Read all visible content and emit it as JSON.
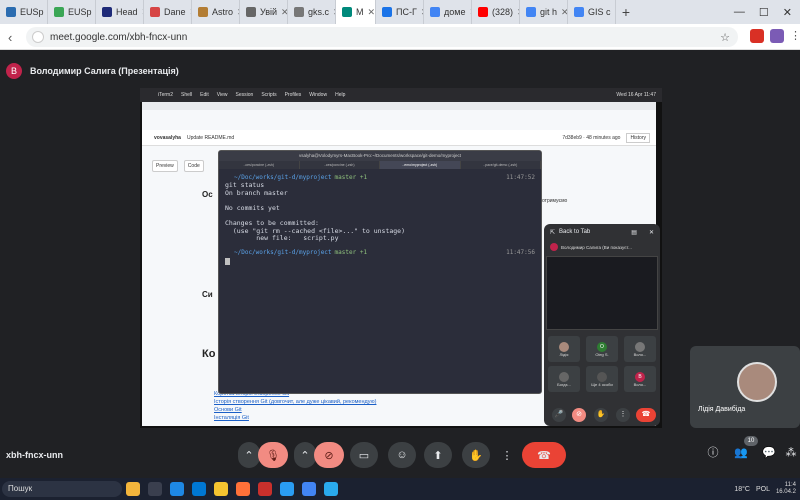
{
  "browser": {
    "tabs": [
      {
        "label": "EUSp",
        "color": "#2b6cb0"
      },
      {
        "label": "EUSp",
        "color": "#3aa655"
      },
      {
        "label": "Head",
        "color": "#1e2a78"
      },
      {
        "label": "Dane",
        "color": "#d64545"
      },
      {
        "label": "Astro",
        "color": "#b37d34"
      },
      {
        "label": "Увій",
        "color": "#666"
      },
      {
        "label": "gks.c",
        "color": "#777"
      },
      {
        "label": "M",
        "color": "#00897b",
        "active": true
      },
      {
        "label": "ПС-Г",
        "color": "#1a73e8"
      },
      {
        "label": "доме",
        "color": "#4285f4"
      },
      {
        "label": "(328)",
        "color": "#ff0000"
      },
      {
        "label": "git h",
        "color": "#4285f4"
      },
      {
        "label": "GIS c",
        "color": "#4285f4"
      }
    ],
    "url": "meet.google.com/xbh-fncx-unn"
  },
  "meet": {
    "presenter_avatar": "В",
    "presenter_title": "Володимир Салига (Презентація)",
    "meeting_code": "xbh-fncx-unn",
    "participants_count": "10"
  },
  "shared": {
    "mac_menu": [
      "iTerm2",
      "Shell",
      "Edit",
      "View",
      "Session",
      "Scripts",
      "Profiles",
      "Window",
      "Help"
    ],
    "mac_clock": "Wed 16 Apr  11:47",
    "gh_user": "vovasalyha",
    "gh_commit": "Update README.md",
    "gh_hash": "7d38eb9 · 48 minutes ago",
    "gh_history": "History",
    "gh_tabs": [
      "Preview",
      "Code"
    ],
    "doc_heading1": "Ос",
    "doc_heading2": "Си",
    "doc_heading3": "Ко",
    "doc_side_text": "отримуємо",
    "toc_links": [
      "Коротка історія створення Git",
      "Історія створення Git (довгочит, але дуже цікавий, рекомендую)",
      "Основи Git",
      "Інсталяція Git"
    ],
    "terminal": {
      "title": "vsalyha@Volodymyrs-MacBook-Pro:~/Documents/workspace/git-demo/myproject",
      "tabs": [
        "..ces/poncine (-zsh)",
        "..ces/poncine (-zsh)",
        "..emo/myproject (-zsh)",
        "..pace/git-demo (-zsh)"
      ],
      "prompt_path": "~/Doc/works/git-d/myproject",
      "branch": "master +1",
      "time1": "11:47:52",
      "time2": "11:47:56",
      "lines": [
        "git status",
        "On branch master",
        "",
        "No commits yet",
        "",
        "Changes to be committed:",
        "  (use \"git rm --cached <file>...\" to unstage)",
        "        new file:   script.py"
      ]
    }
  },
  "pip": {
    "back_label": "Back to Tab",
    "presenting": "Володимир Салига (Ви показуєт...",
    "tiles": [
      {
        "label": "Лідія",
        "initial": "",
        "color": "#a98a7c"
      },
      {
        "label": "Oleg S.",
        "initial": "O",
        "color": "#2e7d32"
      },
      {
        "label": "Воло...",
        "initial": "",
        "color": "#777"
      },
      {
        "label": "Богдз...",
        "initial": "",
        "color": "#666"
      },
      {
        "label": "Ще 4 особи",
        "initial": "",
        "color": "#555"
      },
      {
        "label": "Воло...",
        "initial": "В",
        "color": "#c0234b"
      }
    ]
  },
  "spotlight": {
    "name": "Лідія Давибіда"
  },
  "taskbar": {
    "search": "Пошук",
    "weather": "18°C",
    "lang": "POL",
    "time": "11:4",
    "date": "16.04.2"
  }
}
